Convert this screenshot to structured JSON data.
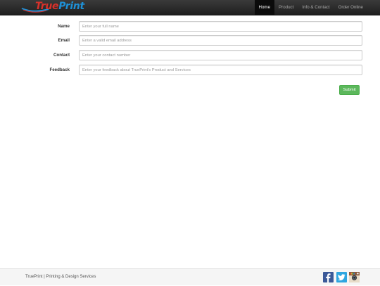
{
  "brand": {
    "name": "TruePrint",
    "colors": {
      "true": "#d8312b",
      "print": "#1e90d6"
    }
  },
  "nav": {
    "items": [
      {
        "label": "Home",
        "active": true
      },
      {
        "label": "Product"
      },
      {
        "label": "Info & Contact"
      },
      {
        "label": "Order Online"
      }
    ]
  },
  "form": {
    "fields": [
      {
        "label": "Name",
        "placeholder": "Enter your full name"
      },
      {
        "label": "Email",
        "placeholder": "Enter a valid email address"
      },
      {
        "label": "Contact",
        "placeholder": "Enter your contact number"
      },
      {
        "label": "Feedback",
        "placeholder": "Enter your feedback about TruePrint's Product and Services"
      }
    ],
    "submit_label": "Submit",
    "submit_color": "#5cb85c"
  },
  "footer": {
    "text": "TruePrint | Printing & Design Services",
    "social": [
      "facebook-icon",
      "twitter-icon",
      "instagram-icon"
    ]
  }
}
